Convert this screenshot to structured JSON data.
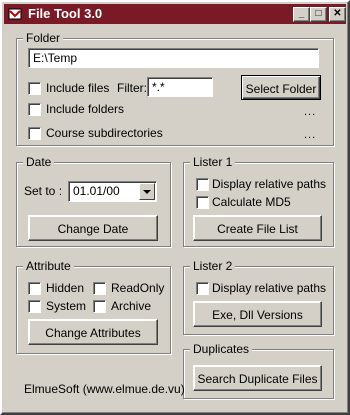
{
  "window": {
    "title": "File Tool 3.0",
    "minimize": "_",
    "maximize": "□",
    "close": "✕"
  },
  "folder": {
    "group_label": "Folder",
    "path_value": "E:\\Temp",
    "include_files_label": "Include files",
    "filter_label": "Filter:",
    "filter_value": "*.*",
    "select_folder_label": "Select Folder",
    "include_folders_label": "Include folders",
    "course_subdirs_label": "Course subdirectories",
    "dots1": "...",
    "dots2": "..."
  },
  "date": {
    "group_label": "Date",
    "set_to_label": "Set to :",
    "date_value": "01.01/00",
    "change_date_label": "Change Date"
  },
  "lister1": {
    "group_label": "Lister 1",
    "relative_paths_label": "Display relative paths",
    "md5_label": "Calculate MD5",
    "create_list_label": "Create File List"
  },
  "attribute": {
    "group_label": "Attribute",
    "hidden_label": "Hidden",
    "readonly_label": "ReadOnly",
    "system_label": "System",
    "archive_label": "Archive",
    "change_attr_label": "Change Attributes"
  },
  "lister2": {
    "group_label": "Lister 2",
    "relative_paths_label": "Display relative paths",
    "exe_dll_label": "Exe, Dll Versions"
  },
  "duplicates": {
    "group_label": "Duplicates",
    "search_label": "Search Duplicate Files"
  },
  "footer": {
    "credit": "ElmueSoft (www.elmue.de.vu)"
  }
}
